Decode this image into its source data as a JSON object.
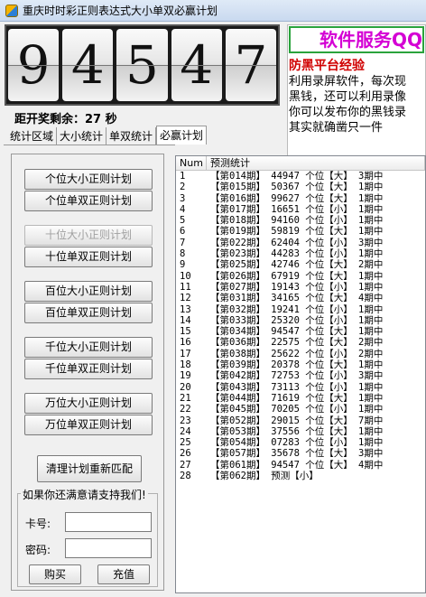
{
  "window": {
    "title": "重庆时时彩正则表达式大小单双必赢计划"
  },
  "digits": [
    "9",
    "4",
    "5",
    "4",
    "7"
  ],
  "ad": {
    "header": "软件服务QQ",
    "subtitle": "防黑平台经验",
    "lines": [
      "利用录屏软件，每次现",
      "黑钱，还可以利用录像",
      "你可以发布你的黑钱录",
      "其实就确凿只一件"
    ]
  },
  "countdown": "距开奖剩余：27 秒",
  "tabs": [
    {
      "label": "统计区域"
    },
    {
      "label": "大小统计"
    },
    {
      "label": "单双统计"
    },
    {
      "label": "必赢计划"
    }
  ],
  "buttons": {
    "ge_big": "个位大小正则计划",
    "ge_odd": "个位单双正则计划",
    "shi_big": "十位大小正则计划",
    "shi_odd": "十位单双正则计划",
    "bai_big": "百位大小正则计划",
    "bai_odd": "百位单双正则计划",
    "qian_big": "千位大小正则计划",
    "qian_odd": "千位单双正则计划",
    "wan_big": "万位大小正则计划",
    "wan_odd": "万位单双正则计划",
    "rematch": "清理计划重新匹配"
  },
  "support": {
    "legend": "如果你还满意请支持我们!",
    "card_label": "卡号:",
    "password_label": "密码:",
    "card_value": "",
    "password_value": "",
    "buy_button": "购买",
    "recharge_button": "充值"
  },
  "list": {
    "columns": [
      "Num",
      "预测统计"
    ],
    "rows": [
      [
        "1",
        "【第014期】 44947  个位【大】 3期中"
      ],
      [
        "2",
        "【第015期】 50367  个位【大】 1期中"
      ],
      [
        "3",
        "【第016期】 99627  个位【大】 1期中"
      ],
      [
        "4",
        "【第017期】 16651  个位【小】 1期中"
      ],
      [
        "5",
        "【第018期】 94160  个位【小】 1期中"
      ],
      [
        "6",
        "【第019期】 59819  个位【大】 1期中"
      ],
      [
        "7",
        "【第022期】 62404  个位【小】 3期中"
      ],
      [
        "8",
        "【第023期】 44283  个位【小】 1期中"
      ],
      [
        "9",
        "【第025期】 42746  个位【大】 2期中"
      ],
      [
        "10",
        "【第026期】 67919  个位【大】 1期中"
      ],
      [
        "11",
        "【第027期】 19143  个位【小】 1期中"
      ],
      [
        "12",
        "【第031期】 34165  个位【大】 4期中"
      ],
      [
        "13",
        "【第032期】 19241  个位【小】 1期中"
      ],
      [
        "14",
        "【第033期】 25320  个位【小】 1期中"
      ],
      [
        "15",
        "【第034期】 94547  个位【大】 1期中"
      ],
      [
        "16",
        "【第036期】 22575  个位【大】 2期中"
      ],
      [
        "17",
        "【第038期】 25622  个位【小】 2期中"
      ],
      [
        "18",
        "【第039期】 20378  个位【大】 1期中"
      ],
      [
        "19",
        "【第042期】 72753  个位【小】 3期中"
      ],
      [
        "20",
        "【第043期】 73113  个位【小】 1期中"
      ],
      [
        "21",
        "【第044期】 71619  个位【大】 1期中"
      ],
      [
        "22",
        "【第045期】 70205  个位【小】 1期中"
      ],
      [
        "23",
        "【第052期】 29015  个位【大】 7期中"
      ],
      [
        "24",
        "【第053期】 37556  个位【大】 1期中"
      ],
      [
        "25",
        "【第054期】 07283  个位【小】 1期中"
      ],
      [
        "26",
        "【第057期】 35678  个位【大】 3期中"
      ],
      [
        "27",
        "【第061期】 94547  个位【大】 4期中"
      ],
      [
        "28",
        "【第062期】 预测【小】"
      ]
    ]
  }
}
